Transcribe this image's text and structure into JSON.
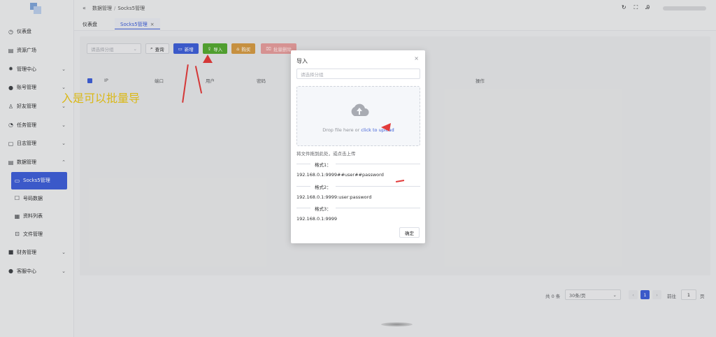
{
  "sidebar": {
    "items": [
      {
        "label": "仪表盘",
        "icon": "dashboard-icon",
        "glyph": "◷",
        "chevron": false
      },
      {
        "label": "资源广场",
        "icon": "database-icon",
        "glyph": "▤",
        "chevron": false
      },
      {
        "label": "管理中心",
        "icon": "gear-icon",
        "glyph": "✹",
        "chevron": true
      },
      {
        "label": "账号管理",
        "icon": "user-icon",
        "glyph": "●",
        "chevron": true
      },
      {
        "label": "好友管理",
        "icon": "user-outline-icon",
        "glyph": "♙",
        "chevron": true
      },
      {
        "label": "任务管理",
        "icon": "task-icon",
        "glyph": "◔",
        "chevron": true
      },
      {
        "label": "日志管理",
        "icon": "chat-icon",
        "glyph": "▢",
        "chevron": true
      },
      {
        "label": "数据管理",
        "icon": "database-icon",
        "glyph": "▤",
        "chevron": true,
        "expanded": true
      }
    ],
    "subitems": [
      {
        "label": "Socks5管理",
        "icon": "monitor-icon",
        "glyph": "▭",
        "active": true
      },
      {
        "label": "号码数据",
        "icon": "phone-icon",
        "glyph": "☐",
        "active": false
      },
      {
        "label": "资料列表",
        "icon": "grid-icon",
        "glyph": "▦",
        "active": false
      },
      {
        "label": "文件管理",
        "icon": "bag-icon",
        "glyph": "⊡",
        "active": false
      }
    ],
    "after": [
      {
        "label": "财务管理",
        "icon": "wallet-icon",
        "glyph": "■",
        "chevron": true
      },
      {
        "label": "客服中心",
        "icon": "user-icon",
        "glyph": "●",
        "chevron": true
      }
    ]
  },
  "header": {
    "breadcrumb": [
      "数据管理",
      "Socks5管理"
    ]
  },
  "tabs": [
    {
      "label": "仪表盘"
    },
    {
      "label": "Socks5管理",
      "closable": true
    }
  ],
  "toolbar": {
    "group_placeholder": "请选择分组",
    "query": "查询",
    "add": "新增",
    "import": "导入",
    "buy": "购买",
    "batch_delete": "批量删除"
  },
  "table": {
    "headers": [
      "IP",
      "端口",
      "用户",
      "密码",
      "操作"
    ]
  },
  "annotation_text": "入是可以批量导",
  "pagination": {
    "total": "共 0 条",
    "page_size": "30条/页",
    "current": "1",
    "goto_label": "前往",
    "goto_value": "1",
    "page_word": "页"
  },
  "modal": {
    "title": "导入",
    "group_placeholder": "请选择分组",
    "upload_text_a": "Drop file here or ",
    "upload_text_b": "click to upload",
    "hint": "将文件拖到此处，或点击上传",
    "formats": [
      {
        "label": "格式1：",
        "example": "192.168.0.1:9999##user##password"
      },
      {
        "label": "格式2：",
        "example": "192.168.0.1:9999:user:password"
      },
      {
        "label": "格式3：",
        "example": "192.168.0.1:9999"
      }
    ],
    "confirm": "确定"
  },
  "colors": {
    "primary": "#3f5fd6",
    "success": "#55a832",
    "warning": "#d39a45",
    "danger": "#e49c9c",
    "annotation": "#e8c41a",
    "arrow": "#e23b3b"
  }
}
